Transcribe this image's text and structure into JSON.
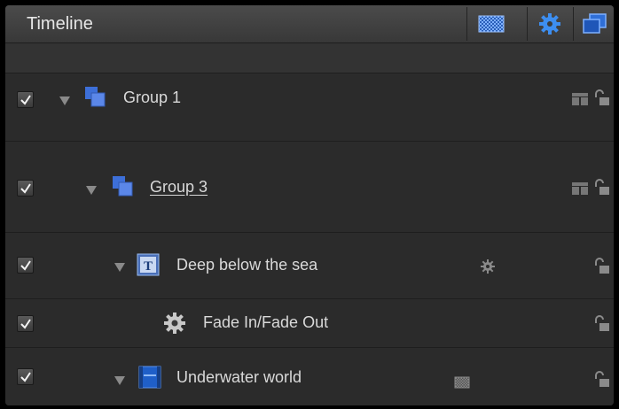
{
  "panel": {
    "title": "Timeline",
    "header_buttons": [
      {
        "name": "show-masks",
        "icon": "mask-checker-icon"
      },
      {
        "name": "show-behaviors",
        "icon": "gear-icon"
      },
      {
        "name": "show-layers",
        "icon": "layers-icon"
      }
    ]
  },
  "layers": [
    {
      "label": "Group 1",
      "checked": true,
      "expanded": true,
      "type": "group",
      "linked": false
    },
    {
      "label": "Group 3",
      "checked": true,
      "expanded": true,
      "type": "group",
      "linked": true
    },
    {
      "label": "Deep below the sea",
      "checked": true,
      "expanded": true,
      "type": "text"
    },
    {
      "label": "Fade In/Fade Out",
      "checked": true,
      "type": "behavior"
    },
    {
      "label": "Underwater world",
      "checked": true,
      "expanded": true,
      "type": "image"
    }
  ],
  "colors": {
    "accent_blue": "#3d7be3",
    "panel_bg": "#2b2b2b",
    "header_bg": "#404040",
    "text": "#d9d9d9"
  }
}
